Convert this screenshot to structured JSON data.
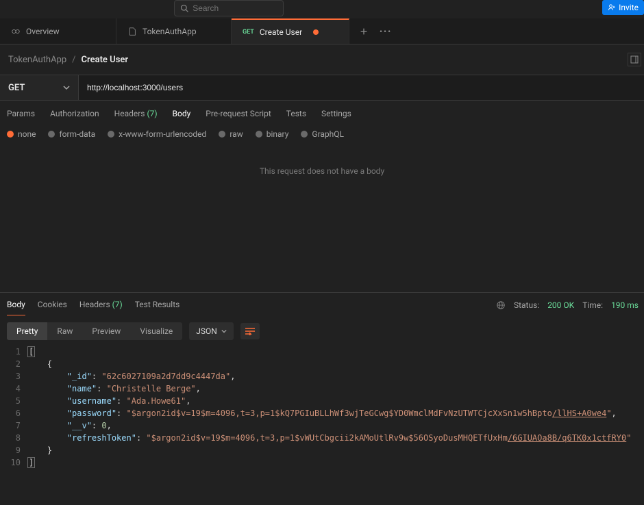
{
  "top": {
    "search_placeholder": "Search",
    "invite_label": "Invite"
  },
  "tabs": [
    {
      "kind": "overview",
      "label": "Overview",
      "active": false
    },
    {
      "kind": "collection",
      "label": "TokenAuthApp",
      "active": false
    },
    {
      "kind": "request",
      "method": "GET",
      "label": "Create User",
      "active": true,
      "dirty": true
    }
  ],
  "breadcrumb": {
    "parent": "TokenAuthApp",
    "current": "Create User"
  },
  "request": {
    "method": "GET",
    "url": "http://localhost:3000/users",
    "tabs": [
      {
        "label": "Params",
        "active": false
      },
      {
        "label": "Authorization",
        "active": false
      },
      {
        "label": "Headers",
        "count": "(7)",
        "active": false
      },
      {
        "label": "Body",
        "active": true
      },
      {
        "label": "Pre-request Script",
        "active": false
      },
      {
        "label": "Tests",
        "active": false
      },
      {
        "label": "Settings",
        "active": false
      }
    ],
    "body_types": [
      {
        "label": "none",
        "selected": true
      },
      {
        "label": "form-data",
        "selected": false
      },
      {
        "label": "x-www-form-urlencoded",
        "selected": false
      },
      {
        "label": "raw",
        "selected": false
      },
      {
        "label": "binary",
        "selected": false
      },
      {
        "label": "GraphQL",
        "selected": false
      }
    ],
    "body_empty_msg": "This request does not have a body"
  },
  "response": {
    "tabs": [
      {
        "label": "Body",
        "active": true
      },
      {
        "label": "Cookies",
        "active": false
      },
      {
        "label": "Headers",
        "count": "(7)",
        "active": false
      },
      {
        "label": "Test Results",
        "active": false
      }
    ],
    "status_label": "Status:",
    "status_value": "200 OK",
    "time_label": "Time:",
    "time_value": "190 ms",
    "view_modes": [
      {
        "label": "Pretty",
        "active": true
      },
      {
        "label": "Raw",
        "active": false
      },
      {
        "label": "Preview",
        "active": false
      },
      {
        "label": "Visualize",
        "active": false
      }
    ],
    "format": "JSON",
    "body": [
      {
        "_id": "62c6027109a2d7dd9c4447da",
        "name": "Christelle Berge",
        "username": "Ada.Howe61",
        "password": "$argon2id$v=19$m=4096,t=3,p=1$kQ7PGIuBLLhWf3wjTeGCwg$YD0WmclMdFvNzUTWTCjcXxSn1w5hBpto/llHS+A0we4",
        "password_underlined_suffix": "/llHS+A0we4",
        "__v": 0,
        "refreshToken": "$argon2id$v=19$m=4096,t=3,p=1$vWUtCbgcii2kAMoUtlRv9w$56OSyoDusMHQETfUxHm/6GIUAOa8B/q6TK0x1ctfRY0",
        "refreshToken_underlined_suffix": "/6GIUAOa8B/q6TK0x1ctfRY0"
      }
    ],
    "line_numbers": [
      "1",
      "2",
      "3",
      "4",
      "5",
      "6",
      "7",
      "8",
      "9",
      "10"
    ]
  }
}
